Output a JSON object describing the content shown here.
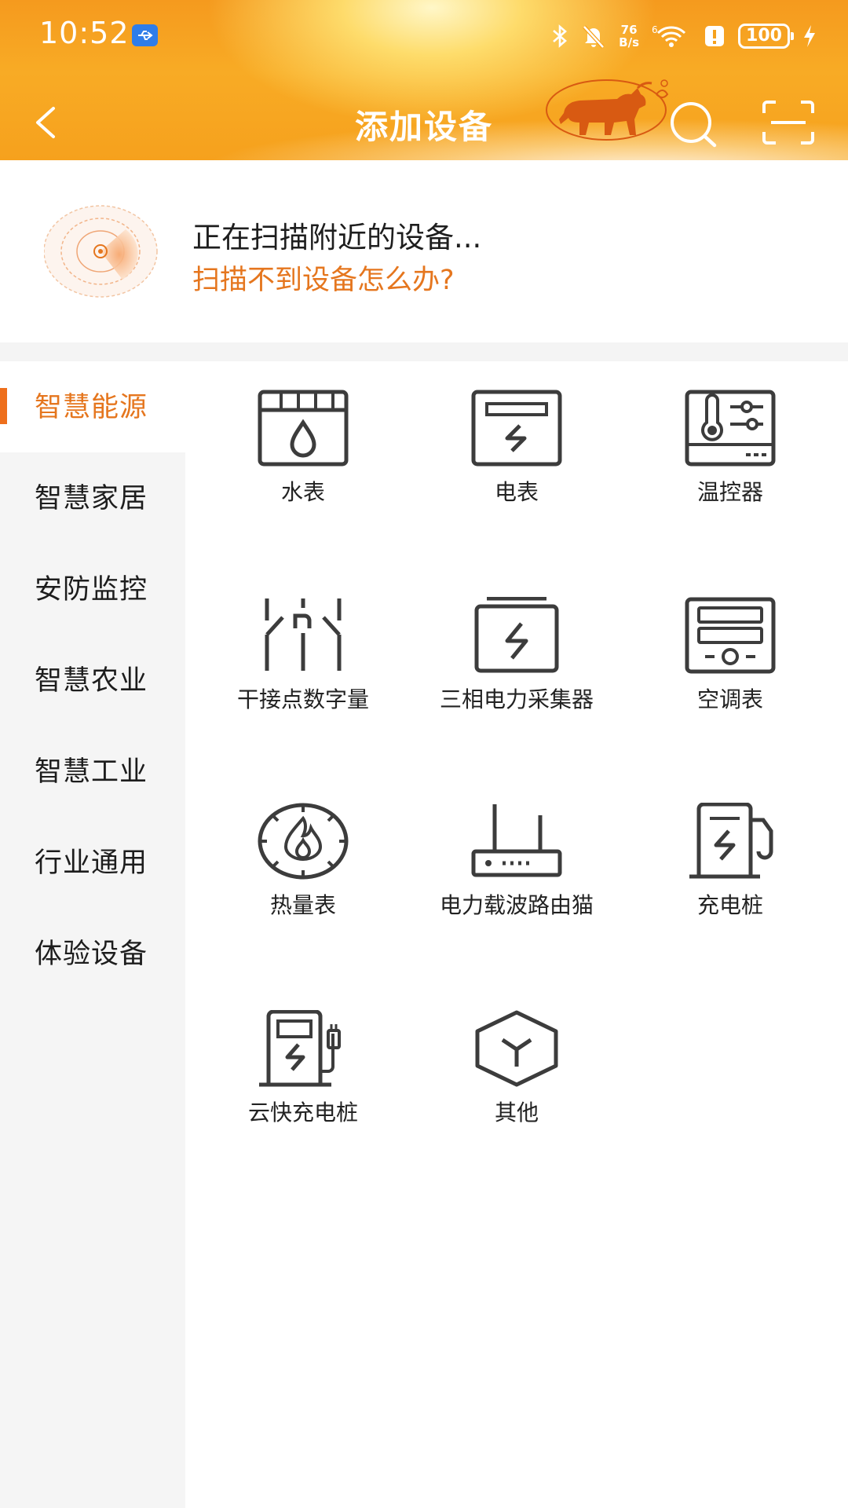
{
  "status_bar": {
    "time": "10:52",
    "net_speed_value": "76",
    "net_speed_unit": "B/s",
    "battery": "100"
  },
  "header": {
    "title": "添加设备"
  },
  "scan": {
    "status_text": "正在扫描附近的设备...",
    "help_link": "扫描不到设备怎么办?"
  },
  "sidebar": {
    "items": [
      {
        "label": "智慧能源",
        "active": true
      },
      {
        "label": "智慧家居",
        "active": false
      },
      {
        "label": "安防监控",
        "active": false
      },
      {
        "label": "智慧农业",
        "active": false
      },
      {
        "label": "智慧工业",
        "active": false
      },
      {
        "label": "行业通用",
        "active": false
      },
      {
        "label": "体验设备",
        "active": false
      }
    ]
  },
  "devices": [
    {
      "label": "水表",
      "icon": "water-meter-icon"
    },
    {
      "label": "电表",
      "icon": "electric-meter-icon"
    },
    {
      "label": "温控器",
      "icon": "thermostat-icon"
    },
    {
      "label": "干接点数字量",
      "icon": "dry-contact-icon"
    },
    {
      "label": "三相电力采集器",
      "icon": "power-collector-icon"
    },
    {
      "label": "空调表",
      "icon": "ac-meter-icon"
    },
    {
      "label": "热量表",
      "icon": "heat-meter-icon"
    },
    {
      "label": "电力载波路由猫",
      "icon": "router-icon"
    },
    {
      "label": "充电桩",
      "icon": "charging-pile-icon"
    },
    {
      "label": "云快充电桩",
      "icon": "cloud-charging-pile-icon"
    },
    {
      "label": "其他",
      "icon": "cube-icon"
    }
  ],
  "colors": {
    "accent": "#e5761e",
    "header_orange": "#f6a11d",
    "sidebar_bg": "#f5f5f5",
    "icon_stroke": "#3c3c3c"
  }
}
